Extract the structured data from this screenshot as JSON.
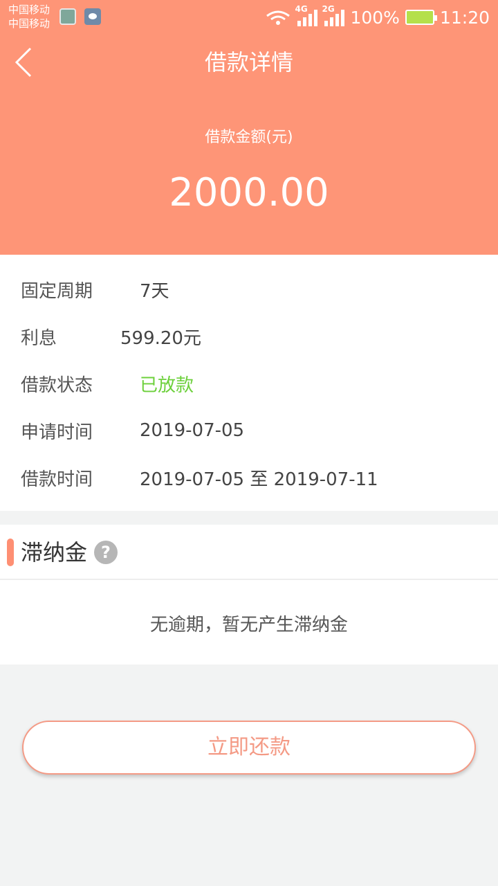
{
  "status_bar": {
    "carrier_1": "中国移动",
    "carrier_2": "中国移动",
    "network_1": "4G",
    "network_2": "2G",
    "battery": "100%",
    "time": "11:20"
  },
  "nav": {
    "title": "借款详情",
    "back_icon": "chevron-left-icon"
  },
  "summary": {
    "amount_label": "借款金额(元)",
    "amount_value": "2000.00"
  },
  "details": [
    {
      "label": "固定周期",
      "value": "7天"
    },
    {
      "label": "利息",
      "value": "599.20元"
    },
    {
      "label": "借款状态",
      "value": "已放款"
    },
    {
      "label": "申请时间",
      "value": "2019-07-05"
    },
    {
      "label": "借款时间",
      "value": "2019-07-05 至 2019-07-11"
    }
  ],
  "late_fee": {
    "title": "滞纳金",
    "help_icon": "?",
    "message": "无逾期，暂无产生滞纳金"
  },
  "actions": {
    "repay_label": "立即还款"
  },
  "colors": {
    "header": "#fe9577",
    "status_green": "#6cd03b",
    "accent": "#fe8f73",
    "button_text": "#f49a85"
  }
}
